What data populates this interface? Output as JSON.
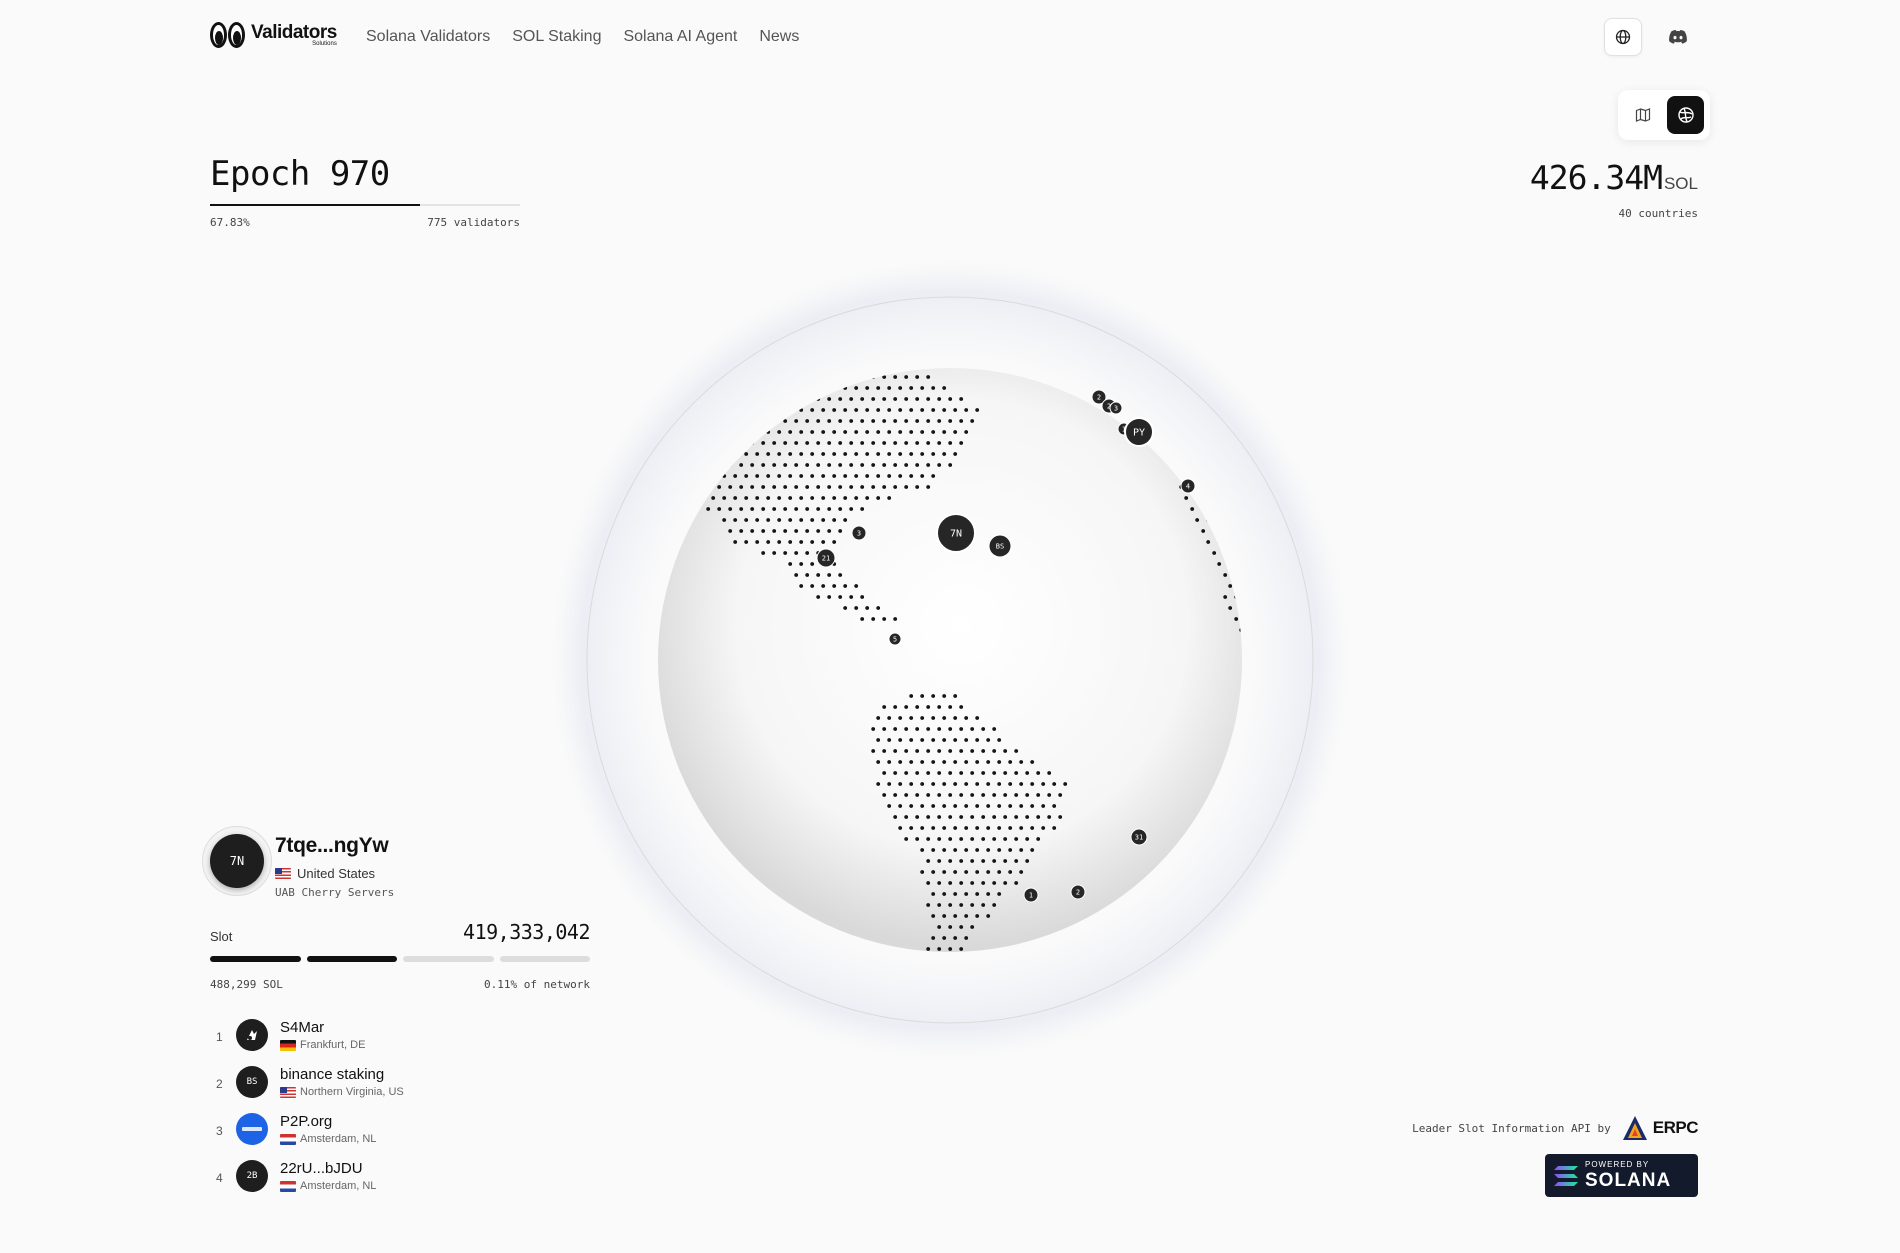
{
  "header": {
    "logo_text": "Validators",
    "logo_sub": "Solutions",
    "nav": [
      "Solana Validators",
      "SOL Staking",
      "Solana AI Agent",
      "News"
    ],
    "globe_icon": "globe-icon",
    "discord_icon": "discord-icon"
  },
  "view_toggle": {
    "options": [
      "map-icon",
      "globe-3d-icon"
    ],
    "active": "globe-3d-icon"
  },
  "epoch": {
    "title": "Epoch 970",
    "progress_percent": 67.83,
    "progress_label": "67.83%",
    "validators_label": "775 validators"
  },
  "stake": {
    "value": "426.34M",
    "unit": "SOL",
    "countries": "40 countries"
  },
  "globe": {
    "markers": [
      "2",
      "2",
      "3",
      "1",
      "PY",
      "4",
      "3",
      "7N",
      "BS",
      "21",
      "5",
      "31",
      "1",
      "2"
    ]
  },
  "current_validator": {
    "initials": "7N",
    "name": "7tqe...ngYw",
    "country": "United States",
    "host": "UAB Cherry Servers"
  },
  "slot": {
    "label": "Slot",
    "value": "419,333,042",
    "segments_total": 4,
    "segments_done": 2,
    "sol": "488,299 SOL",
    "network_share": "0.11% of network"
  },
  "leaders": [
    {
      "num": "1",
      "initials": "",
      "name": "S4Mar",
      "flag": "de",
      "location": "Frankfurt, DE"
    },
    {
      "num": "2",
      "initials": "BS",
      "name": "binance staking",
      "flag": "us",
      "location": "Northern Virginia, US"
    },
    {
      "num": "3",
      "initials": "",
      "name": "P2P.org",
      "flag": "nl",
      "location": "Amsterdam, NL"
    },
    {
      "num": "4",
      "initials": "2B",
      "name": "22rU...bJDU",
      "flag": "nl",
      "location": "Amsterdam, NL"
    }
  ],
  "credit": {
    "text": "Leader Slot Information API by",
    "brand": "ERPC"
  },
  "solana_badge": {
    "powered": "POWERED BY",
    "name": "SOLANA"
  },
  "colors": {
    "background": "#fafafa",
    "accent": "#111111",
    "p2p_blue": "#1d63e6",
    "solana_badge_bg": "#121a2c"
  }
}
